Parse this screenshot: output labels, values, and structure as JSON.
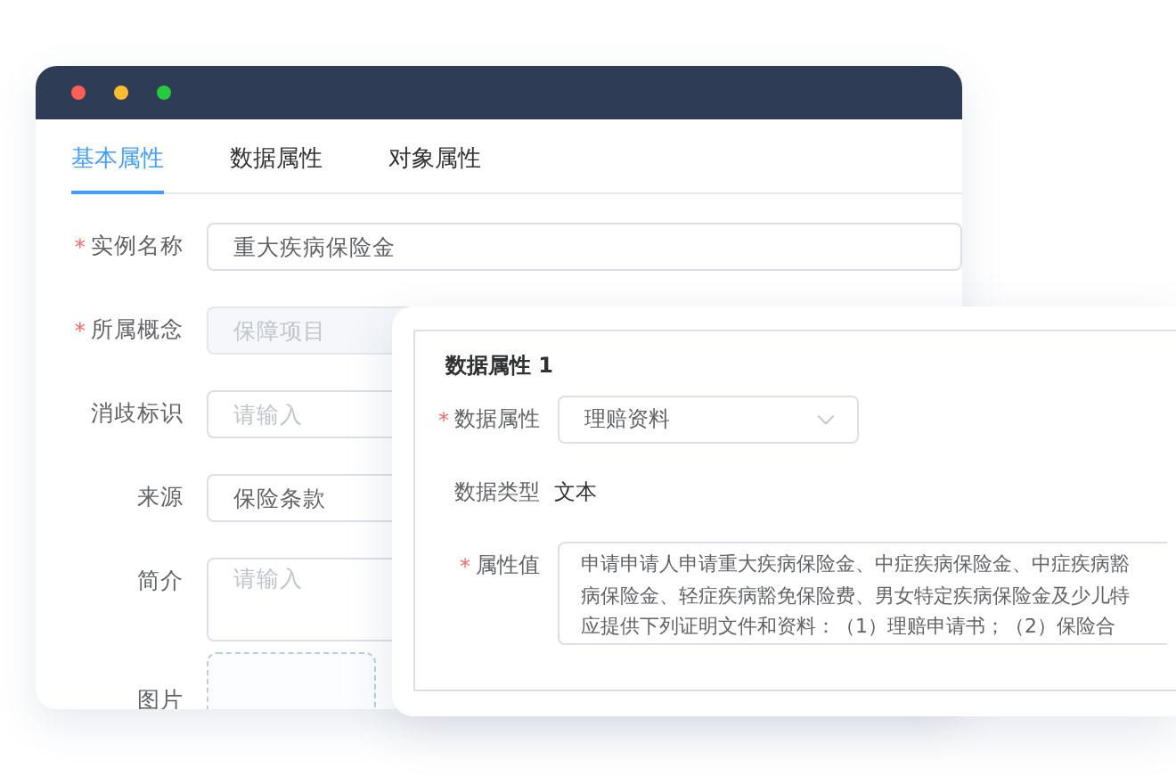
{
  "window": {
    "controls": [
      {
        "color": "#ff5f57"
      },
      {
        "color": "#febc2e"
      },
      {
        "color": "#28c840"
      }
    ]
  },
  "tabs": [
    {
      "label": "基本属性",
      "selected": true
    },
    {
      "label": "数据属性",
      "selected": false
    },
    {
      "label": "对象属性",
      "selected": false
    }
  ],
  "form": {
    "fields": [
      {
        "kind": "input",
        "required_mark": "*",
        "label": "实例名称",
        "value": "重大疾病保险金"
      },
      {
        "kind": "input",
        "required_mark": "*",
        "label": "所属概念",
        "value": "保障项目",
        "disabled": true
      },
      {
        "kind": "input",
        "label": "消歧标识",
        "placeholder": "请输入"
      },
      {
        "kind": "input",
        "label": "来源",
        "value": "保险条款"
      },
      {
        "kind": "textarea",
        "label": "简介",
        "placeholder": "请输入"
      },
      {
        "kind": "upload",
        "label": "图片"
      }
    ]
  },
  "data_property_dialog": {
    "title": "数据属性 1",
    "fields": [
      {
        "kind": "select",
        "required_mark": "*",
        "label": "数据属性",
        "value": "理赔资料"
      },
      {
        "kind": "text",
        "label": "数据类型",
        "value": "文本"
      },
      {
        "kind": "textarea",
        "required_mark": "*",
        "label": "属性值",
        "lines": [
          "申请申请人申请重大疾病保险金、中症疾病保险金、中症疾病豁",
          "病保险金、轻症疾病豁免保险费、男女特定疾病保险金及少儿特",
          "应提供下列证明文件和资料：（1）理赔申请书；（2）保险合"
        ]
      }
    ]
  }
}
